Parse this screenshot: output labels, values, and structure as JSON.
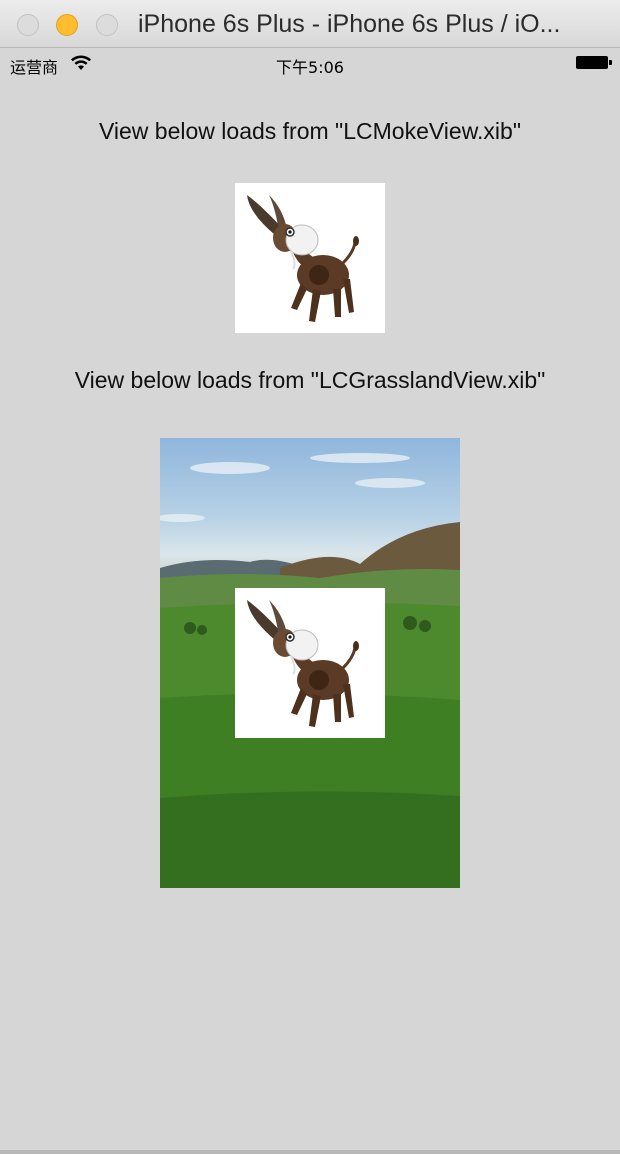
{
  "window": {
    "title": "iPhone 6s Plus - iPhone 6s Plus / iO..."
  },
  "status_bar": {
    "carrier": "运营商",
    "time": "下午5:06"
  },
  "labels": {
    "moke": "View below loads from \"LCMokeView.xib\"",
    "grassland": "View below loads from \"LCGrasslandView.xib\""
  },
  "colors": {
    "background": "#d6d6d6",
    "minimize_light": "#febc2e"
  },
  "icons": [
    "close-icon",
    "minimize-icon",
    "zoom-icon",
    "wifi-icon",
    "battery-icon",
    "donkey-image",
    "grassland-image"
  ]
}
